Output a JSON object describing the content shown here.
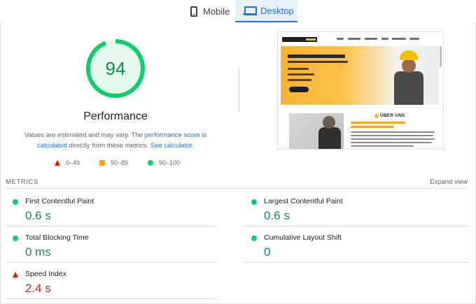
{
  "tabs": [
    {
      "label": "Mobile",
      "icon": "phone-icon",
      "active": false
    },
    {
      "label": "Desktop",
      "icon": "laptop-icon",
      "active": true
    }
  ],
  "score": {
    "value": 94,
    "fraction": 0.94,
    "label": "Performance",
    "color": "#0cce6b"
  },
  "disclaimer": {
    "text_1": "Values are estimated and may vary. The ",
    "link_1": "performance score is calculated",
    "text_2": " directly from these metrics. ",
    "link_2": "See calculator",
    "text_3": "."
  },
  "legend": [
    {
      "range": "0–49",
      "shape": "triangle",
      "color": "#eb0f00"
    },
    {
      "range": "50–89",
      "shape": "square",
      "color": "#ffa400"
    },
    {
      "range": "90–100",
      "shape": "circle",
      "color": "#0cce6b"
    }
  ],
  "screenshot": {
    "section_heading": "ÜBER UNS"
  },
  "metrics": {
    "heading": "METRICS",
    "expand_label": "Expand view",
    "items": [
      {
        "name": "First Contentful Paint",
        "value": "0.6 s",
        "status": "good"
      },
      {
        "name": "Largest Contentful Paint",
        "value": "0.6 s",
        "status": "good"
      },
      {
        "name": "Total Blocking Time",
        "value": "0 ms",
        "status": "good"
      },
      {
        "name": "Cumulative Layout Shift",
        "value": "0",
        "status": "good"
      },
      {
        "name": "Speed Index",
        "value": "2.4 s",
        "status": "poor"
      }
    ]
  },
  "colors": {
    "accent": "#1a73e8",
    "good": "#0cce6b",
    "average": "#ffa400",
    "poor": "#eb0f00"
  }
}
